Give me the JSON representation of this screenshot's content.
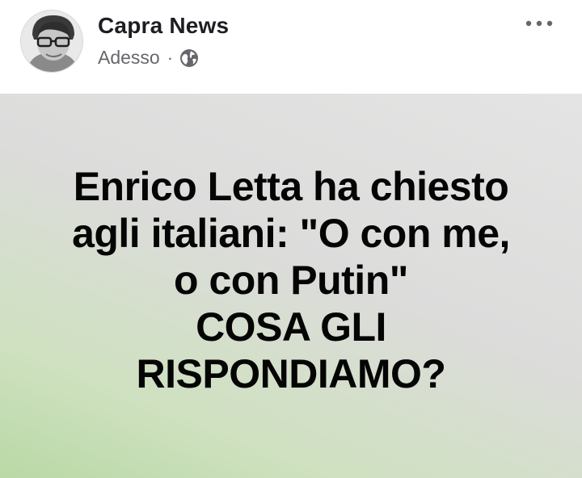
{
  "post": {
    "author": "Capra News",
    "timestamp": "Adesso",
    "separator": "·",
    "privacy_icon": "globe-icon",
    "menu_icon": "more-options-icon",
    "avatar_icon": "avatar-photo",
    "text_lines": [
      "Enrico Letta ha chiesto",
      "agli italiani: \"O con me,",
      "o con Putin\"",
      "COSA GLI",
      "RISPONDIAMO?"
    ],
    "background_colors": [
      "#b9d9a6",
      "#dcdcdb",
      "#e4e4e4"
    ]
  }
}
